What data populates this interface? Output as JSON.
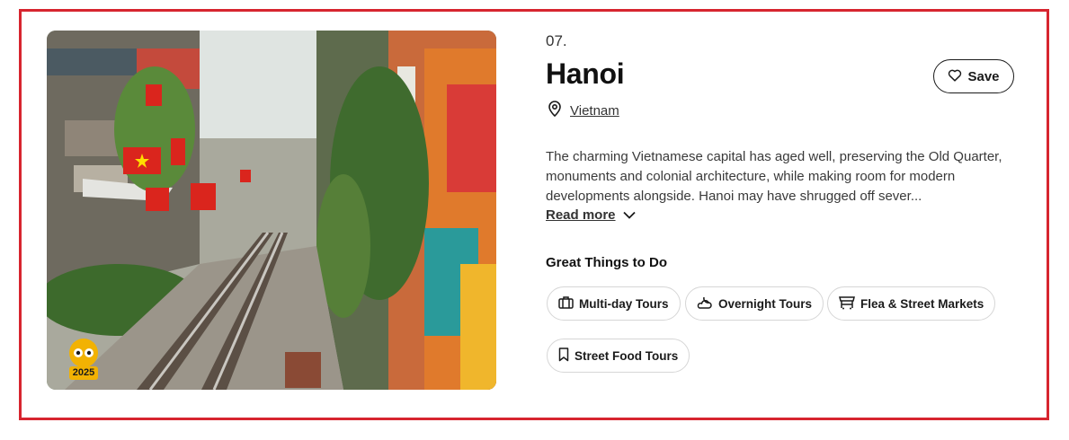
{
  "card": {
    "rank": "07.",
    "city": "Hanoi",
    "save_label": "Save",
    "country": "Vietnam",
    "description": "The charming Vietnamese capital has aged well, preserving the Old Quarter, monuments and colonial architecture, while making room for modern developments alongside. Hanoi may have shrugged off sever...",
    "read_more": "Read more",
    "badge_year": "2025"
  },
  "things_to_do": {
    "heading": "Great Things to Do",
    "chips": [
      {
        "label": "Multi-day Tours",
        "icon": "briefcase-icon"
      },
      {
        "label": "Overnight Tours",
        "icon": "moon-cloud-icon"
      },
      {
        "label": "Flea & Street Markets",
        "icon": "market-stall-icon"
      },
      {
        "label": "Street Food Tours",
        "icon": "bookmark-icon"
      }
    ]
  },
  "colors": {
    "frame_border": "#d7252f",
    "badge": "#f2b203",
    "text": "#1a1a1a"
  }
}
